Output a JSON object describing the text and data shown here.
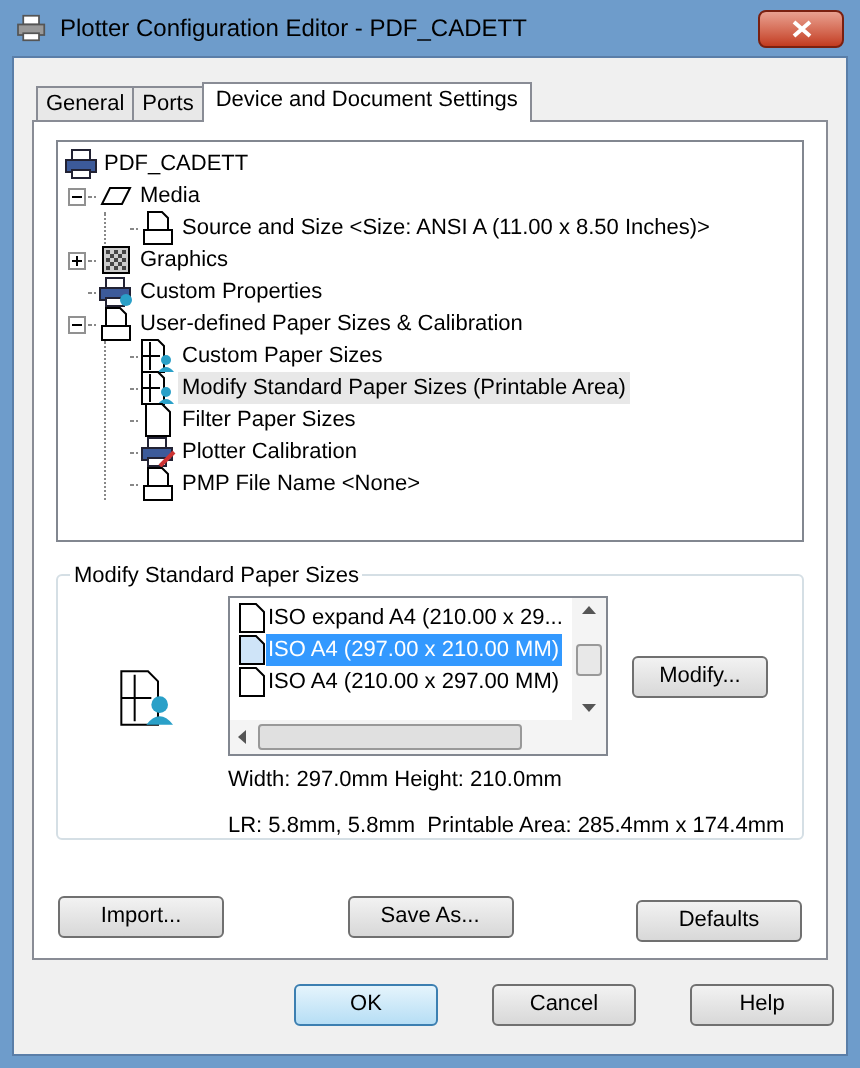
{
  "window": {
    "title": "Plotter Configuration Editor - PDF_CADETT"
  },
  "tabs": [
    {
      "label": "General",
      "selected": false
    },
    {
      "label": "Ports",
      "selected": false
    },
    {
      "label": "Device and Document Settings",
      "selected": true
    }
  ],
  "tree": {
    "label": "PDF_CADETT",
    "kind": "printer",
    "selected": false,
    "children": [
      {
        "label": "Media",
        "kind": "media",
        "expanded": true,
        "selected": false,
        "children": [
          {
            "label": "Source and Size <Size: ANSI A (11.00 x 8.50 Inches)>",
            "kind": "tray",
            "selected": false
          }
        ]
      },
      {
        "label": "Graphics",
        "kind": "graphics",
        "expanded": false,
        "selected": false
      },
      {
        "label": "Custom Properties",
        "kind": "printer-user",
        "selected": false
      },
      {
        "label": "User-defined Paper Sizes & Calibration",
        "kind": "paper-tray",
        "expanded": true,
        "selected": false,
        "children": [
          {
            "label": "Custom Paper Sizes",
            "kind": "paper-user",
            "selected": false
          },
          {
            "label": "Modify Standard Paper Sizes (Printable Area)",
            "kind": "paper-user",
            "selected": true
          },
          {
            "label": "Filter Paper Sizes",
            "kind": "page",
            "selected": false
          },
          {
            "label": "Plotter Calibration",
            "kind": "printer-pencil",
            "selected": false
          },
          {
            "label": "PMP File Name <None>",
            "kind": "paper-tray",
            "selected": false
          }
        ]
      }
    ]
  },
  "group": {
    "title": "Modify Standard Paper Sizes",
    "sizes": [
      {
        "label": "ISO expand A4 (210.00 x 29...",
        "selected": false
      },
      {
        "label": "ISO A4 (297.00 x 210.00 MM)",
        "selected": true
      },
      {
        "label": "ISO A4 (210.00 x 297.00 MM)",
        "selected": false
      }
    ],
    "modify_button": "Modify...",
    "dimensions": "Width: 297.0mm Height: 210.0mm",
    "margins": "LR: 5.8mm, 5.8mm  Printable Area: 285.4mm x 174.4mm"
  },
  "panel_buttons": [
    "Import...",
    "Save As...",
    "Defaults"
  ],
  "dialog_buttons": [
    {
      "label": "OK",
      "default": true
    },
    {
      "label": "Cancel",
      "default": false
    },
    {
      "label": "Help",
      "default": false
    }
  ]
}
